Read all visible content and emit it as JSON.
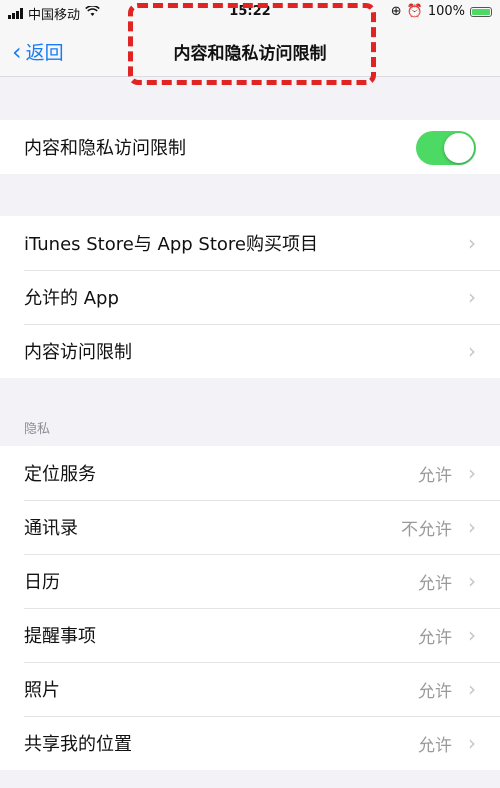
{
  "status_bar": {
    "carrier": "中国移动",
    "time": "15:22",
    "battery": "100%",
    "signal_icon": "signal-bars-icon",
    "wifi_icon": "wifi-icon",
    "rotation_lock_icon": "rotation-lock-icon",
    "alarm_icon": "alarm-icon",
    "battery_icon": "battery-charging-icon"
  },
  "nav": {
    "back_label": "返回",
    "title": "内容和隐私访问限制"
  },
  "main_toggle": {
    "label": "内容和隐私访问限制",
    "state": "on",
    "color": "#4cd964"
  },
  "store_group": [
    {
      "label": "iTunes Store与 App Store购买项目"
    },
    {
      "label": "允许的 App"
    },
    {
      "label": "内容访问限制"
    }
  ],
  "privacy": {
    "header": "隐私",
    "items": [
      {
        "label": "定位服务",
        "value": "允许"
      },
      {
        "label": "通讯录",
        "value": "不允许"
      },
      {
        "label": "日历",
        "value": "允许"
      },
      {
        "label": "提醒事项",
        "value": "允许"
      },
      {
        "label": "照片",
        "value": "允许"
      },
      {
        "label": "共享我的位置",
        "value": "允许"
      }
    ]
  },
  "colors": {
    "accent_blue": "#1a7cf5",
    "highlight_red": "#e02424",
    "toggle_green": "#4cd964"
  }
}
